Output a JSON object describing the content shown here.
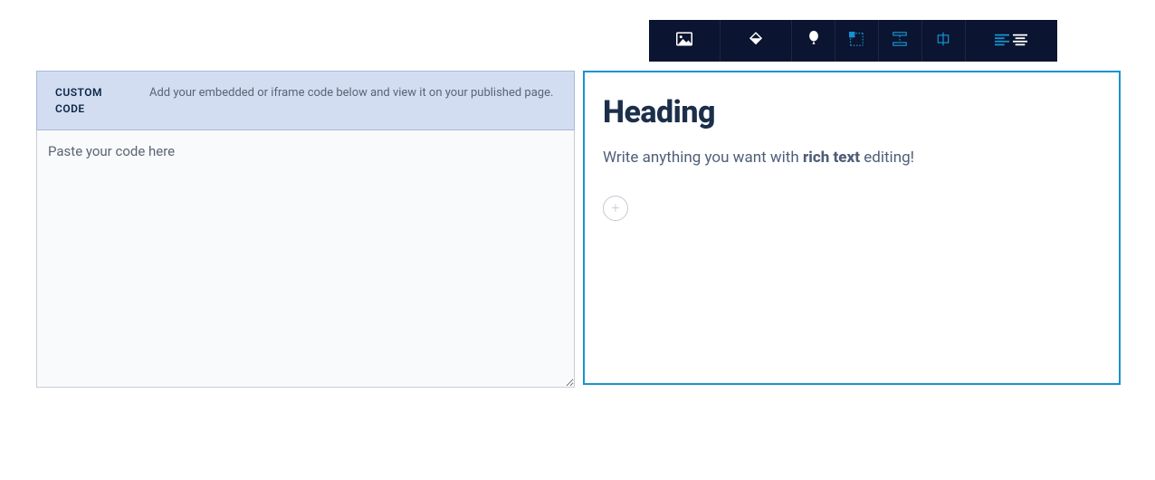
{
  "toolbar": {
    "items": [
      {
        "name": "image-icon"
      },
      {
        "name": "fill-icon"
      },
      {
        "name": "balloon-icon"
      },
      {
        "name": "size-icon"
      },
      {
        "name": "spacing-icon"
      },
      {
        "name": "align-center-icon"
      },
      {
        "name": "align-left-icon"
      },
      {
        "name": "align-justify-icon"
      }
    ]
  },
  "customCode": {
    "label_l1": "CUSTOM",
    "label_l2": "CODE",
    "description": "Add your embedded or iframe code below and view it on your published page.",
    "placeholder": "Paste your code here"
  },
  "editor": {
    "heading": "Heading",
    "body_before": "Write anything you want with ",
    "body_bold": "rich text",
    "body_after": " editing!",
    "add_label": "+"
  }
}
